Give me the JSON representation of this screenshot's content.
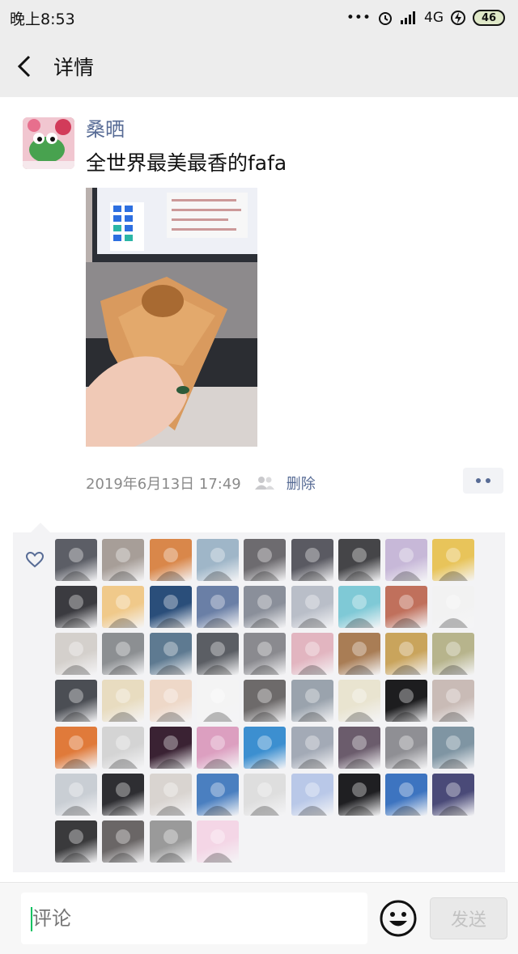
{
  "status_bar": {
    "time": "晚上8:53",
    "dots": "•••",
    "network": "4G",
    "battery": "46"
  },
  "nav": {
    "back_icon": "chevron-left-icon",
    "title": "详情"
  },
  "post": {
    "author": "桑晒",
    "text": "全世界最美最香的fafa",
    "timestamp": "2019年6月13日 17:49",
    "visibility_icon": "people-icon",
    "delete_label": "删除",
    "more_icon": "more-dots-icon"
  },
  "likes": {
    "icon": "heart-icon",
    "count": 58,
    "colors": [
      "#5c5e66",
      "#a79e98",
      "#d9874a",
      "#9fb6c8",
      "#6d6b6f",
      "#5a5a62",
      "#454548",
      "#c7b8d8",
      "#e8c45a",
      "#3b3b40",
      "#f0c98a",
      "#2a4e7a",
      "#6a7fa6",
      "#8a8f9a",
      "#b9bec8",
      "#7fc9d6",
      "#c0705c",
      "#f2f2f2",
      "#d4d0cc",
      "#8c8f92",
      "#5e7a91",
      "#5b5e64",
      "#8a8a8f",
      "#e2b5c0",
      "#a97d55",
      "#c9a45c",
      "#b7b48c",
      "#4b4e54",
      "#e8dcc0",
      "#eed8c8",
      "#f4f4f4",
      "#6d6a6a",
      "#9aa3ad",
      "#e9e4d0",
      "#1d1d1f",
      "#c9bbb6",
      "#e07a3a",
      "#d4d4d4",
      "#3a2233",
      "#dc9fc0",
      "#3c8fd0",
      "#a3aab6",
      "#6b5c6c",
      "#8f8f94",
      "#7f95a3",
      "#c9ced4",
      "#2e2e32",
      "#d9d4d0",
      "#4a7fc0",
      "#dedede",
      "#b9c8e8",
      "#1f1f22",
      "#3d74c0",
      "#4a4a78",
      "#3a3a3c",
      "#6a6666",
      "#9a9a9a",
      "#f4d6e6"
    ]
  },
  "comment_bar": {
    "placeholder": "评论",
    "emoji_icon": "emoji-icon",
    "send_label": "发送"
  }
}
